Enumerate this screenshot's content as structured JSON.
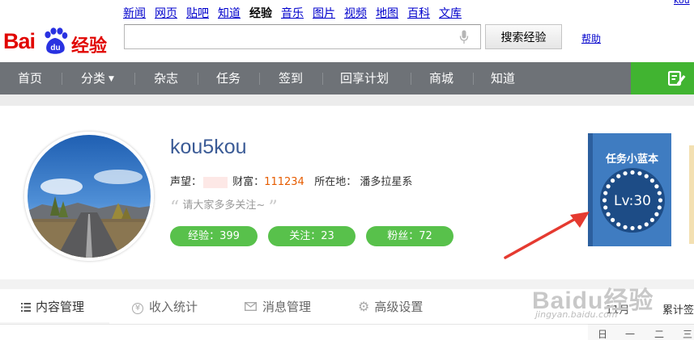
{
  "header": {
    "logo_latin": "Bai",
    "logo_du": "du",
    "logo_cn": "经验",
    "top_nav": [
      "新闻",
      "网页",
      "贴吧",
      "知道",
      "经验",
      "音乐",
      "图片",
      "视频",
      "地图",
      "百科",
      "文库"
    ],
    "active_top_nav": "经验",
    "corner_link": "kou",
    "search_value": "",
    "search_button": "搜索经验",
    "help_link": "帮助"
  },
  "main_nav": {
    "items": [
      "首页",
      "分类",
      "杂志",
      "任务",
      "签到",
      "回享计划",
      "商城",
      "知道"
    ],
    "accent_color": "#41b431"
  },
  "profile": {
    "username": "kou5kou",
    "reputation_label": "声望：",
    "wealth_label": "财富：",
    "wealth_value": "111234",
    "location_label": "所在地：",
    "location_value": "潘多拉星系",
    "motto": "请大家多多关注~",
    "stats": [
      "经验：399",
      "关注：23",
      "粉丝：72"
    ]
  },
  "taskbook": {
    "title": "任务小蓝本",
    "level": "Lv:30",
    "color": "#3f7cc1"
  },
  "tabs": {
    "items": [
      "内容管理",
      "收入统计",
      "消息管理",
      "高级设置"
    ],
    "icons": [
      "list-icon",
      "yen-icon",
      "mail-icon",
      "gear-icon"
    ],
    "active": 0
  },
  "calendar": {
    "month": "11月",
    "total_label": "累计签",
    "weekdays": [
      "日",
      "一",
      "二",
      "三"
    ]
  },
  "watermark": {
    "text": "Baidu经验",
    "url": "jingyan.baidu.com"
  }
}
